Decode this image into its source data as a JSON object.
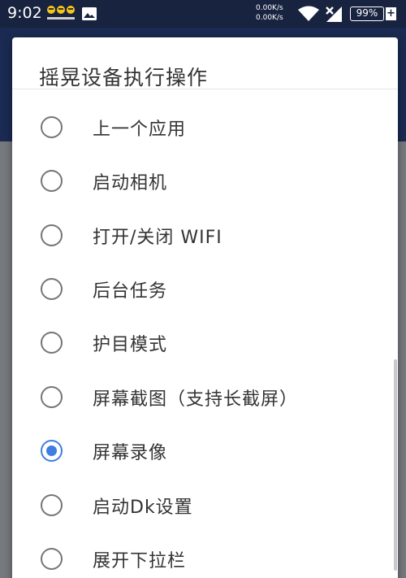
{
  "status_bar": {
    "time": "9:02",
    "net_up": "0.00K/s",
    "net_down": "0.00K/s",
    "battery": "99%",
    "battery_charging": "+"
  },
  "dialog": {
    "title": "摇晃设备执行操作",
    "options": [
      {
        "label": "上一个应用",
        "checked": false
      },
      {
        "label": "启动相机",
        "checked": false
      },
      {
        "label": "打开/关闭 WIFI",
        "checked": false
      },
      {
        "label": "后台任务",
        "checked": false
      },
      {
        "label": "护目模式",
        "checked": false
      },
      {
        "label": "屏幕截图（支持长截屏）",
        "checked": false
      },
      {
        "label": "屏幕录像",
        "checked": true
      },
      {
        "label": "启动Dk设置",
        "checked": false
      },
      {
        "label": "展开下拉栏",
        "checked": false
      }
    ]
  },
  "colors": {
    "accent": "#3f7ee0",
    "status_bar": "#17233f",
    "radio_unchecked": "#757575"
  }
}
